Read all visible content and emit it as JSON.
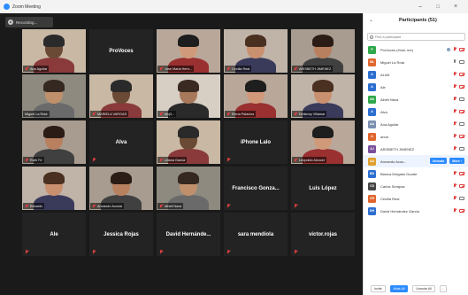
{
  "window": {
    "title": "Zoom Meeting",
    "minimize": "–",
    "maximize": "□",
    "close": "×"
  },
  "recording": {
    "label": "Recording..."
  },
  "tiles": [
    {
      "name": "Ana Aguilar",
      "video": true,
      "muted": true
    },
    {
      "name": "ProVoces",
      "video": false,
      "muted": false
    },
    {
      "name": "Jose Maria Hern...",
      "video": true,
      "muted": true
    },
    {
      "name": "Cecilia Real",
      "video": true,
      "muted": true
    },
    {
      "name": "ARISBETH JIMENEZ",
      "video": true,
      "muted": true
    },
    {
      "name": "Miguel La Rota",
      "video": true,
      "muted": false
    },
    {
      "name": "MARIELA VARGAS",
      "video": true,
      "muted": true
    },
    {
      "name": "mcj3...",
      "video": true,
      "muted": true
    },
    {
      "name": "Elena Palacios",
      "video": true,
      "muted": true
    },
    {
      "name": "Dellanny Villamar",
      "video": true,
      "muted": true
    },
    {
      "name": "Ruth Fe",
      "video": true,
      "muted": true
    },
    {
      "name": "Alva",
      "video": false,
      "muted": true
    },
    {
      "name": "Liliana Garcia",
      "video": true,
      "muted": true
    },
    {
      "name": "iPhone Lalo",
      "video": false,
      "muted": true
    },
    {
      "name": "Leopoldo Alcocer",
      "video": true,
      "muted": true
    },
    {
      "name": "Eduardo",
      "video": true,
      "muted": true
    },
    {
      "name": "Armando Acosta",
      "video": true,
      "muted": true
    },
    {
      "name": "Alheli Nava",
      "video": true,
      "muted": true
    },
    {
      "name": "Francisco Gonza...",
      "video": false,
      "muted": true
    },
    {
      "name": "Luis López",
      "video": false,
      "muted": true
    },
    {
      "name": "Ale",
      "video": false,
      "muted": true
    },
    {
      "name": "Jessica Rojas",
      "video": false,
      "muted": true
    },
    {
      "name": "David Hernánde...",
      "video": false,
      "muted": true
    },
    {
      "name": "sara mendiola",
      "video": false,
      "muted": true
    },
    {
      "name": "victor.rojas",
      "video": false,
      "muted": true
    }
  ],
  "panel": {
    "title": "Participants (51)",
    "collapse": "⌄",
    "search_placeholder": "Find a participant",
    "participants": [
      {
        "initials": "P",
        "color": "#2ea84a",
        "name": "ProVoces (Host, me)",
        "mic": "off",
        "cam": "off",
        "host": true
      },
      {
        "initials": "ML",
        "color": "#e0662d",
        "name": "Miguel La Rota",
        "mic": "on",
        "cam": "on"
      },
      {
        "initials": "A",
        "color": "#2d6fd0",
        "name": "ALAN",
        "mic": "off",
        "cam": "off"
      },
      {
        "initials": "A",
        "color": "#2d6fd0",
        "name": "Ale",
        "mic": "off",
        "cam": "off"
      },
      {
        "initials": "AN",
        "color": "#2ea84a",
        "name": "Alheli Nava",
        "mic": "off",
        "cam": "on"
      },
      {
        "initials": "A",
        "color": "#2d6fd0",
        "name": "Alva",
        "mic": "off",
        "cam": "off"
      },
      {
        "initials": "AA",
        "color": "#7a8fb0",
        "name": "Ana Aguilar",
        "mic": "off",
        "cam": "on",
        "photo": true
      },
      {
        "initials": "A",
        "color": "#e0662d",
        "name": "anna",
        "mic": "off",
        "cam": "off"
      },
      {
        "initials": "AJ",
        "color": "#7a4f9a",
        "name": "ARISBETH JIMENEZ",
        "mic": "off",
        "cam": "on",
        "photo": true
      },
      {
        "initials": "AA",
        "color": "#e0a02d",
        "name": "Armando Acos...",
        "mic": "off",
        "cam": "on",
        "actions": [
          "Unmute",
          "More ›"
        ]
      },
      {
        "initials": "BD",
        "color": "#2d6fd0",
        "name": "Blanca Delgado Duarte",
        "mic": "off",
        "cam": "off"
      },
      {
        "initials": "CS",
        "color": "#444444",
        "name": "Carlos Serapaz",
        "mic": "off",
        "cam": "off",
        "photo": true
      },
      {
        "initials": "CR",
        "color": "#e0662d",
        "name": "Cecilia Real",
        "mic": "off",
        "cam": "on"
      },
      {
        "initials": "DH",
        "color": "#2d6fd0",
        "name": "David Hernández Garcia",
        "mic": "off",
        "cam": "off"
      }
    ],
    "footer": {
      "invite": "Invite",
      "mute_all": "Mute All",
      "unmute_all": "Unmute All",
      "more": "..."
    }
  }
}
